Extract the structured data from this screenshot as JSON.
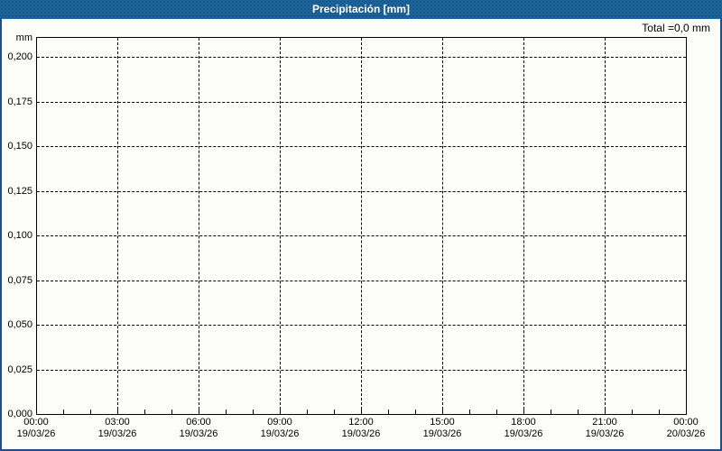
{
  "header": {
    "title": "Precipitación [mm]",
    "bg_color": "#1e689f",
    "text_color": "#ffffff"
  },
  "colors": {
    "window_border": "#1d4f8c",
    "background": "#fcfdf8",
    "grid": "#000000",
    "axis": "#000000",
    "label_text": "#000000"
  },
  "chart_data": {
    "type": "line",
    "title": "Precipitación [mm]",
    "total_label": "Total =0,0 mm",
    "ylabel_unit": "mm",
    "xlabel": "",
    "ylim": [
      0.0,
      0.2
    ],
    "y_tick_step": 0.025,
    "y_ticks": [
      "0,200",
      "0,175",
      "0,150",
      "0,125",
      "0,100",
      "0,075",
      "0,050",
      "0,025",
      "0,000"
    ],
    "x_ticks": [
      {
        "time": "00:00",
        "date": "19/03/26"
      },
      {
        "time": "03:00",
        "date": "19/03/26"
      },
      {
        "time": "06:00",
        "date": "19/03/26"
      },
      {
        "time": "09:00",
        "date": "19/03/26"
      },
      {
        "time": "12:00",
        "date": "19/03/26"
      },
      {
        "time": "15:00",
        "date": "19/03/26"
      },
      {
        "time": "18:00",
        "date": "19/03/26"
      },
      {
        "time": "21:00",
        "date": "19/03/26"
      },
      {
        "time": "00:00",
        "date": "20/03/26"
      }
    ],
    "minor_x_tick_interval_hours": 1,
    "grid": "dashed, both axes",
    "legend": "none",
    "series": [
      {
        "name": "Precipitación",
        "values": []
      }
    ]
  }
}
